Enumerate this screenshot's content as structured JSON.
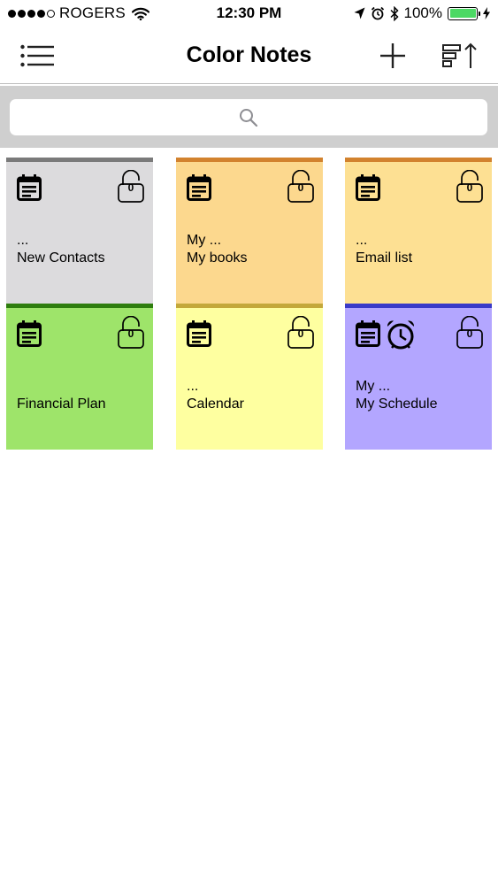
{
  "status_bar": {
    "carrier": "ROGERS",
    "time": "12:30 PM",
    "battery_percent": "100%",
    "signal_bars": 4,
    "signal_total": 5,
    "battery_color": "#4cd964"
  },
  "nav": {
    "title": "Color Notes",
    "menu_icon": "hamburger-menu-icon",
    "add_icon": "plus-icon",
    "sort_icon": "sort-icon"
  },
  "search": {
    "placeholder": "",
    "icon": "search-icon"
  },
  "notes": [
    {
      "preview": "...",
      "title": "New Contacts",
      "lock_count": "0",
      "bg": "#dcdbdd",
      "bar": "#7a7a7a",
      "alarm": false
    },
    {
      "preview": "My ...",
      "title": "My books",
      "lock_count": "0",
      "bg": "#fcd88e",
      "bar": "#d2822e",
      "alarm": false
    },
    {
      "preview": "...",
      "title": "Email list",
      "lock_count": "0",
      "bg": "#fde093",
      "bar": "#d2822e",
      "alarm": false
    },
    {
      "preview": "",
      "title": "Financial Plan",
      "lock_count": "0",
      "bg": "#9ee46a",
      "bar": "#2e7d0e",
      "alarm": false
    },
    {
      "preview": "...",
      "title": "Calendar",
      "lock_count": "0",
      "bg": "#feffa0",
      "bar": "#c4a83a",
      "alarm": false
    },
    {
      "preview": "My ...",
      "title": "My Schedule",
      "lock_count": "0",
      "bg": "#b3a6ff",
      "bar": "#3a3ac8",
      "alarm": true
    }
  ]
}
